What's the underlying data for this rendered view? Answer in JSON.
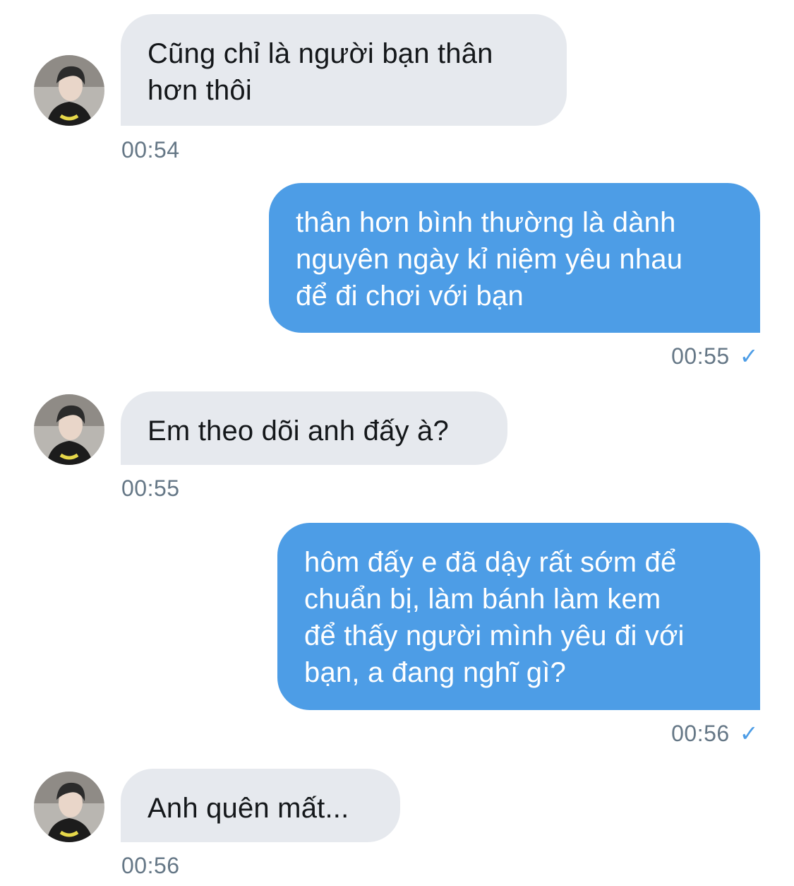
{
  "conversation": {
    "messages": [
      {
        "direction": "incoming",
        "lines": [
          "Cũng chỉ là người bạn thân",
          "hơn thôi"
        ],
        "time": "00:54"
      },
      {
        "direction": "outgoing",
        "lines": [
          "thân hơn bình thường là dành",
          "nguyên ngày kỉ niệm yêu nhau",
          "để đi chơi với bạn"
        ],
        "time": "00:55",
        "status_icon": "checkmark-icon",
        "status_glyph": "✓"
      },
      {
        "direction": "incoming",
        "lines": [
          "Em theo dõi anh đấy à?"
        ],
        "time": "00:55"
      },
      {
        "direction": "outgoing",
        "lines": [
          "hôm đấy e đã dậy rất sớm để",
          "chuẩn bị, làm bánh làm kem",
          "để thấy người mình yêu đi với",
          "bạn, a đang nghĩ gì?"
        ],
        "time": "00:56",
        "status_icon": "checkmark-icon",
        "status_glyph": "✓"
      },
      {
        "direction": "incoming",
        "lines": [
          "Anh quên mất..."
        ],
        "time": "00:56"
      }
    ]
  },
  "colors": {
    "incoming_bubble": "#e6e9ee",
    "outgoing_bubble": "#4d9de6",
    "incoming_text": "#14171a",
    "outgoing_text": "#ffffff",
    "timestamp": "#657786",
    "checkmark": "#4d9de6"
  }
}
